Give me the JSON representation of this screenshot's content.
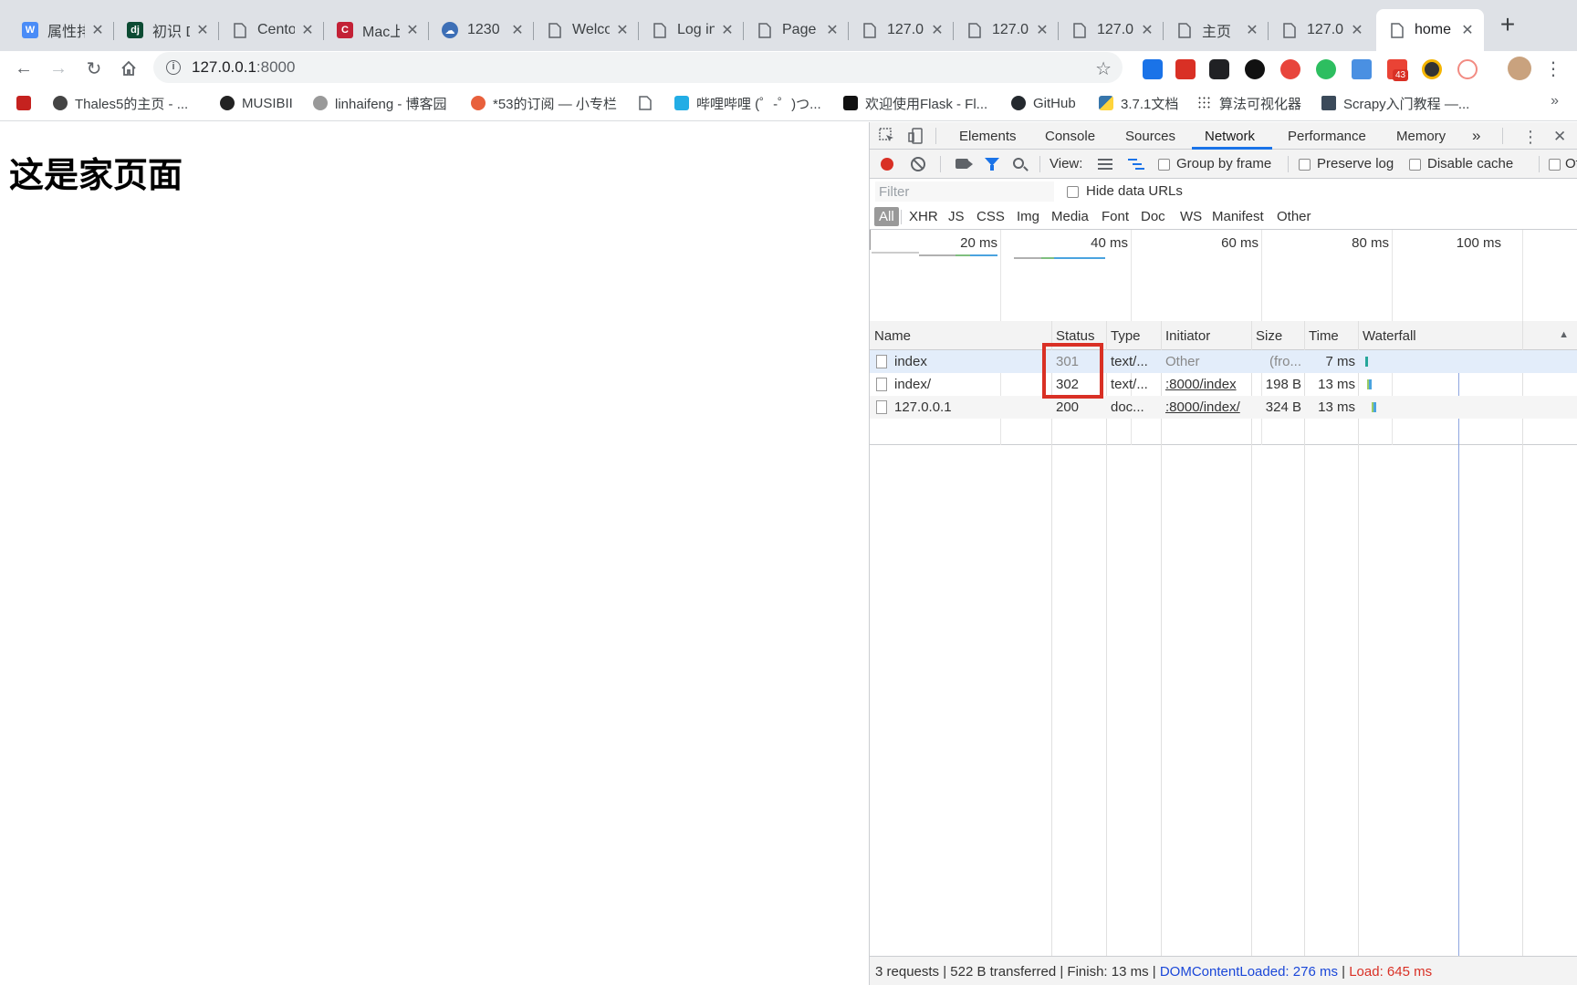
{
  "tabs": [
    {
      "title": "属性排",
      "favicon": "word-icon",
      "color": "#4a8cf7",
      "glyph": "W"
    },
    {
      "title": "初识 D",
      "favicon": "django-icon",
      "color": "#0c4b33",
      "glyph": "dj"
    },
    {
      "title": "Cento",
      "favicon": "document-icon"
    },
    {
      "title": "Mac上",
      "favicon": "csdn-icon",
      "color": "#c32136",
      "glyph": "C"
    },
    {
      "title": "1230",
      "favicon": "cloud-icon",
      "color": "#3d6fb6",
      "glyph": "☁"
    },
    {
      "title": "Welco",
      "favicon": "document-icon"
    },
    {
      "title": "Log in",
      "favicon": "document-icon"
    },
    {
      "title": "Page",
      "favicon": "document-icon"
    },
    {
      "title": "127.0.",
      "favicon": "document-icon"
    },
    {
      "title": "127.0.",
      "favicon": "document-icon"
    },
    {
      "title": "127.0.",
      "favicon": "document-icon"
    },
    {
      "title": "主页",
      "favicon": "document-icon"
    },
    {
      "title": "127.0.",
      "favicon": "document-icon"
    },
    {
      "title": "home",
      "favicon": "document-icon",
      "active": true
    }
  ],
  "address": {
    "host": "127.0.0.1",
    "port": ":8000"
  },
  "extension_badge": "43",
  "bookmarks": [
    {
      "label": "",
      "icon": "apps-icon"
    },
    {
      "label": "Thales5的主页 - ...",
      "icon": "thales-icon"
    },
    {
      "label": "MUSIBII",
      "icon": "notion-icon"
    },
    {
      "label": "linhaifeng - 博客园",
      "icon": "cnblogs-icon"
    },
    {
      "label": "*53的订阅 — 小专栏",
      "icon": "xiaozhuanlan-icon"
    },
    {
      "label": "",
      "icon": "document-icon"
    },
    {
      "label": "哔哩哔哩 (゜-゜)つ...",
      "icon": "bilibili-icon"
    },
    {
      "label": "欢迎使用Flask - Fl...",
      "icon": "flask-icon"
    },
    {
      "label": "GitHub",
      "icon": "github-icon"
    },
    {
      "label": "3.7.1文档",
      "icon": "python-icon"
    },
    {
      "label": "算法可视化器",
      "icon": "algo-icon"
    },
    {
      "label": "Scrapy入门教程 —...",
      "icon": "scrapy-icon"
    }
  ],
  "page": {
    "heading": "这是家页面"
  },
  "devtools": {
    "tabs": [
      "Elements",
      "Console",
      "Sources",
      "Network",
      "Performance",
      "Memory"
    ],
    "active_tab": "Network",
    "more": "»",
    "view_label": "View:",
    "group_by_frame": "Group by frame",
    "preserve_log": "Preserve log",
    "disable_cache": "Disable cache",
    "offline": "Of",
    "filter_placeholder": "Filter",
    "hide_data_urls": "Hide data URLs",
    "filter_types": [
      "All",
      "XHR",
      "JS",
      "CSS",
      "Img",
      "Media",
      "Font",
      "Doc",
      "WS",
      "Manifest",
      "Other"
    ],
    "overview_ticks": [
      "20 ms",
      "40 ms",
      "60 ms",
      "80 ms",
      "100 ms"
    ],
    "columns": [
      "Name",
      "Status",
      "Type",
      "Initiator",
      "Size",
      "Time",
      "Waterfall"
    ],
    "sort_indicator": "▲",
    "rows": [
      {
        "name": "index",
        "status": "301",
        "type": "text/...",
        "initiator": "Other",
        "size": "(fro...",
        "time": "7 ms"
      },
      {
        "name": "index/",
        "status": "302",
        "type": "text/...",
        "initiator": ":8000/index",
        "size": "198 B",
        "time": "13 ms"
      },
      {
        "name": "127.0.0.1",
        "status": "200",
        "type": "doc...",
        "initiator": ":8000/index/",
        "size": "324 B",
        "time": "13 ms"
      }
    ],
    "summary": "3 requests | 522 B transferred | Finish: 13 ms | ",
    "dom_content_loaded": "DOMContentLoaded: 276 ms",
    "load_sep": " | ",
    "load": "Load: 645 ms"
  }
}
